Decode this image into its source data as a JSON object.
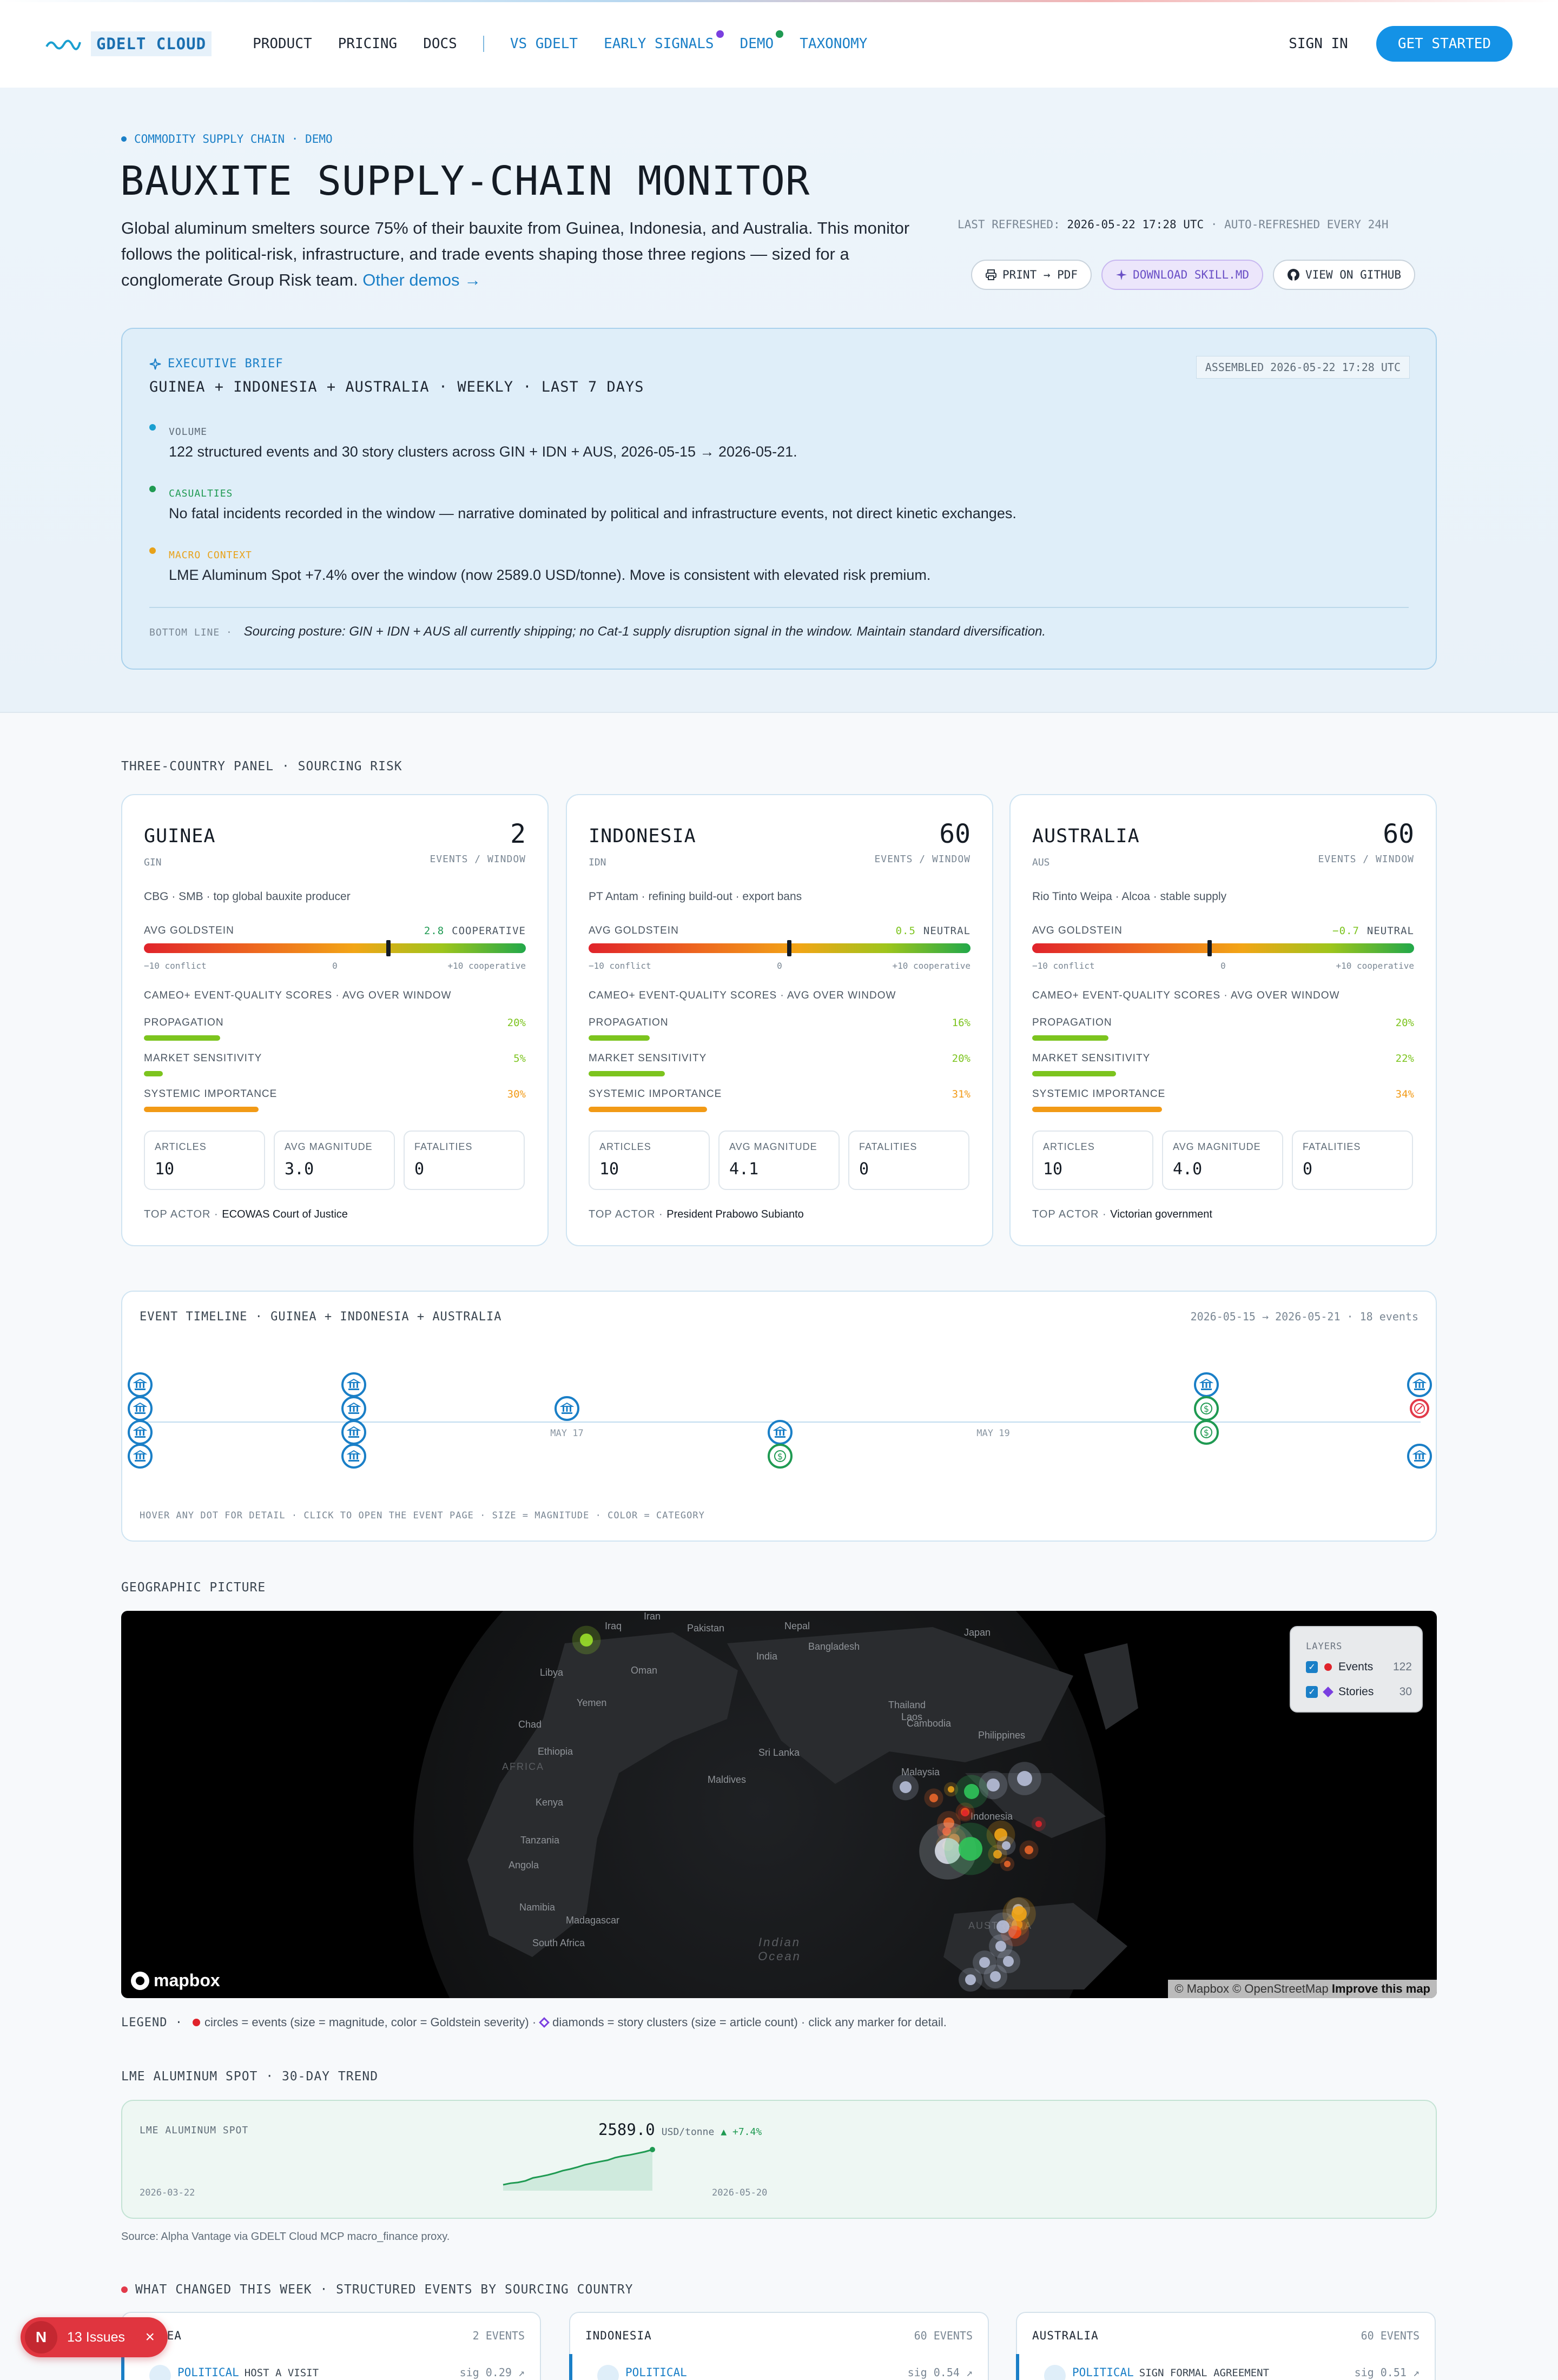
{
  "nav": {
    "logo": "GDELT CLOUD",
    "links": [
      "PRODUCT",
      "PRICING",
      "DOCS"
    ],
    "accent_links": [
      "VS GDELT",
      "EARLY SIGNALS",
      "DEMO",
      "TAXONOMY"
    ],
    "signin": "SIGN IN",
    "cta": "GET STARTED",
    "colors": {
      "accent": "#1a7fc7",
      "cta": "#1492e6",
      "signals_dot": "#7a3fe0",
      "demo_dot": "#1f9a52"
    }
  },
  "hero": {
    "eyebrow": "COMMODITY SUPPLY CHAIN · DEMO",
    "title": "BAUXITE SUPPLY-CHAIN MONITOR",
    "description": "Global aluminum smelters source 75% of their bauxite from Guinea, Indonesia, and Australia. This monitor follows the political-risk, infrastructure, and trade events shaping those three regions — sized for a conglomerate Group Risk team.",
    "other_demos": "Other demos →",
    "refresh_label": "LAST REFRESHED:",
    "refresh_time": "2026-05-22 17:28 UTC",
    "refresh_note": "· AUTO-REFRESHED EVERY 24H",
    "buttons": {
      "print": "PRINT → PDF",
      "skill": "DOWNLOAD SKILL.MD",
      "github": "VIEW ON GITHUB"
    }
  },
  "brief": {
    "label": "EXECUTIVE BRIEF",
    "subtitle": "GUINEA + INDONESIA + AUSTRALIA · WEEKLY · LAST 7 DAYS",
    "assembled": "ASSEMBLED 2026-05-22 17:28 UTC",
    "items": [
      {
        "label": "VOLUME",
        "text": "122 structured events and 30 story clusters across GIN + IDN + AUS, 2026-05-15 → 2026-05-21.",
        "color": "#1a9fd0"
      },
      {
        "label": "CASUALTIES",
        "text": "No fatal incidents recorded in the window — narrative dominated by political and infrastructure events, not direct kinetic exchanges.",
        "color": "#1f9a52"
      },
      {
        "label": "MACRO CONTEXT",
        "text": "LME Aluminum Spot +7.4% over the window (now 2589.0 USD/tonne). Move is consistent with elevated risk premium.",
        "color": "#e8a21a"
      }
    ],
    "bottom_label": "BOTTOM LINE ·",
    "bottom_text": "Sourcing posture: GIN + IDN + AUS all currently shipping; no Cat-1 supply disruption signal in the window. Maintain standard diversification."
  },
  "panel": {
    "heading": "THREE-COUNTRY PANEL · SOURCING RISK",
    "goldstein_label": "AVG GOLDSTEIN",
    "scale_left": "−10 conflict",
    "scale_mid": "0",
    "scale_right": "+10 cooperative",
    "cameo_label": "CAMEO+ EVENT-QUALITY SCORES · AVG OVER WINDOW",
    "events_label": "EVENTS / WINDOW",
    "score_labels": [
      "PROPAGATION",
      "MARKET SENSITIVITY",
      "SYSTEMIC IMPORTANCE"
    ],
    "stat_labels": [
      "ARTICLES",
      "AVG MAGNITUDE",
      "FATALITIES"
    ],
    "actor_label": "TOP ACTOR ·",
    "countries": [
      {
        "name": "GUINEA",
        "code": "GIN",
        "events": "2",
        "desc": "CBG · SMB · top global bauxite producer",
        "goldstein": 2.8,
        "goldstein_text": "2.8",
        "goldstein_class": "COOPERATIVE",
        "goldstein_color": "#1f9a52",
        "scores": [
          {
            "pct": 20,
            "text": "20%",
            "color": "#7cc41e"
          },
          {
            "pct": 5,
            "text": "5%",
            "color": "#7cc41e"
          },
          {
            "pct": 30,
            "text": "30%",
            "color": "#f29a16"
          }
        ],
        "stats": [
          "10",
          "3.0",
          "0"
        ],
        "actor": "ECOWAS Court of Justice"
      },
      {
        "name": "INDONESIA",
        "code": "IDN",
        "events": "60",
        "desc": "PT Antam · refining build-out · export bans",
        "goldstein": 0.5,
        "goldstein_text": "0.5",
        "goldstein_class": "NEUTRAL",
        "goldstein_color": "#7cc41e",
        "scores": [
          {
            "pct": 16,
            "text": "16%",
            "color": "#7cc41e"
          },
          {
            "pct": 20,
            "text": "20%",
            "color": "#7cc41e"
          },
          {
            "pct": 31,
            "text": "31%",
            "color": "#f29a16"
          }
        ],
        "stats": [
          "10",
          "4.1",
          "0"
        ],
        "actor": "President Prabowo Subianto"
      },
      {
        "name": "AUSTRALIA",
        "code": "AUS",
        "events": "60",
        "desc": "Rio Tinto Weipa · Alcoa · stable supply",
        "goldstein": -0.7,
        "goldstein_text": "−0.7",
        "goldstein_class": "NEUTRAL",
        "goldstein_color": "#7cc41e",
        "scores": [
          {
            "pct": 20,
            "text": "20%",
            "color": "#7cc41e"
          },
          {
            "pct": 22,
            "text": "22%",
            "color": "#7cc41e"
          },
          {
            "pct": 34,
            "text": "34%",
            "color": "#f29a16"
          }
        ],
        "stats": [
          "10",
          "4.0",
          "0"
        ],
        "actor": "Victorian government"
      }
    ]
  },
  "timeline": {
    "title": "EVENT TIMELINE · GUINEA + INDONESIA + AUSTRALIA",
    "range": "2026-05-15 → 2026-05-21 · 18 events",
    "ticks": [
      "MAY 17",
      "MAY 19"
    ],
    "footer": "HOVER ANY DOT FOR DETAIL · CLICK TO OPEN THE EVENT PAGE  ·  SIZE = MAGNITUDE · COLOR = CATEGORY",
    "event_icons": {
      "political": "bank-icon",
      "economic": "dollar-icon",
      "conflict": "alert-icon"
    }
  },
  "map": {
    "heading": "GEOGRAPHIC PICTURE",
    "labels": [
      "Iraq",
      "Iran",
      "Pakistan",
      "Nepal",
      "Bangladesh",
      "India",
      "Japan",
      "Libya",
      "Oman",
      "Yemen",
      "Chad",
      "Ethiopia",
      "AFRICA",
      "Thailand",
      "Laos",
      "Cambodia",
      "Philippines",
      "Sri Lanka",
      "Maldives",
      "Malaysia",
      "Indonesia",
      "Kenya",
      "Tanzania",
      "Angola",
      "Namibia",
      "Madagascar",
      "South Africa",
      "AUSTRALIA",
      "Indian Ocean"
    ],
    "layers_title": "LAYERS",
    "layers": [
      {
        "name": "Events",
        "count": "122",
        "color": "#e0232b"
      },
      {
        "name": "Stories",
        "count": "30",
        "color": "#7a3fe0"
      }
    ],
    "mapbox": "mapbox",
    "attribution": "© Mapbox © OpenStreetMap",
    "improve": "Improve this map"
  },
  "legend": {
    "label": "LEGEND ·",
    "circles": "circles = events (size = magnitude, color = Goldstein severity) ·",
    "diamonds": "diamonds = story clusters (size = article count) · click any marker for detail."
  },
  "lme": {
    "heading": "LME ALUMINUM SPOT · 30-DAY TREND",
    "label": "LME ALUMINUM SPOT",
    "value": "2589.0",
    "unit": "USD/tonne",
    "change": "▲ +7.4%",
    "start_date": "2026-03-22",
    "end_date": "2026-05-20",
    "source": "Source: Alpha Vantage via GDELT Cloud MCP macro_finance proxy."
  },
  "chart_data": {
    "type": "area",
    "title": "",
    "series": [
      {
        "values": [
          2410,
          2418,
          2422,
          2430,
          2445,
          2452,
          2460,
          2470,
          2482,
          2490,
          2500,
          2512,
          2520,
          2528,
          2535,
          2548,
          2556,
          2562,
          2570,
          2578,
          2589
        ]
      }
    ],
    "x": [
      "2026-03-22",
      "2026-05-20"
    ],
    "grid": false,
    "legend": "none"
  },
  "changes": {
    "heading": "WHAT CHANGED THIS WEEK · STRUCTURED EVENTS BY SOURCING COUNTRY",
    "cards": [
      {
        "name": "GUINEA",
        "count": "2 EVENTS",
        "category": "POLITICAL",
        "type": "HOST A VISIT",
        "sig": "sig 0.29 ↗"
      },
      {
        "name": "INDONESIA",
        "count": "60 EVENTS",
        "category": "POLITICAL",
        "type": "",
        "sig": "sig 0.54 ↗"
      },
      {
        "name": "AUSTRALIA",
        "count": "60 EVENTS",
        "category": "POLITICAL",
        "type": "SIGN FORMAL AGREEMENT",
        "sig": "sig 0.51 ↗"
      }
    ]
  },
  "issues": {
    "badge": "N",
    "text": "13 Issues",
    "close": "×"
  }
}
